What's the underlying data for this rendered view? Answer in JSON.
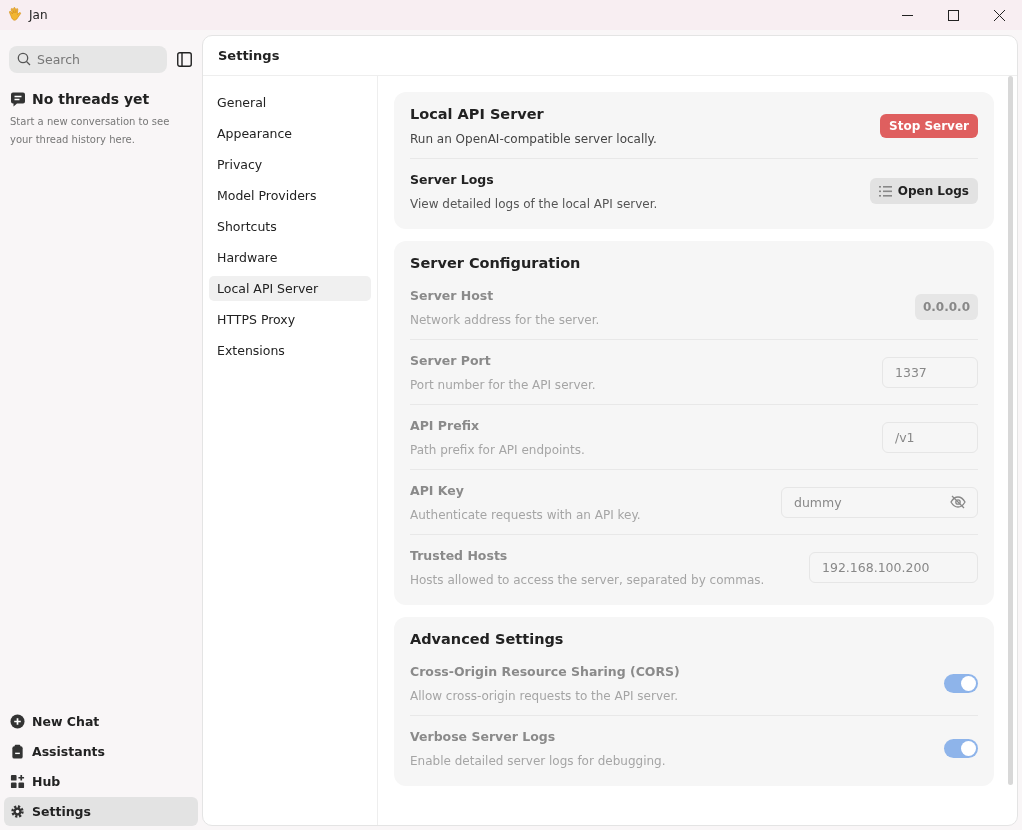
{
  "window": {
    "title": "Jan"
  },
  "sidebar": {
    "search": {
      "placeholder": "Search"
    },
    "empty_state": {
      "title": "No threads yet",
      "description": "Start a new conversation to see your thread history here."
    },
    "nav": [
      {
        "kind": "new-chat",
        "label": "New Chat",
        "selected": false
      },
      {
        "kind": "assistants",
        "label": "Assistants",
        "selected": false
      },
      {
        "kind": "hub",
        "label": "Hub",
        "selected": false
      },
      {
        "kind": "settings",
        "label": "Settings",
        "selected": true
      }
    ]
  },
  "settings": {
    "title": "Settings",
    "menu": [
      {
        "label": "General",
        "selected": false
      },
      {
        "label": "Appearance",
        "selected": false
      },
      {
        "label": "Privacy",
        "selected": false
      },
      {
        "label": "Model Providers",
        "selected": false
      },
      {
        "label": "Shortcuts",
        "selected": false
      },
      {
        "label": "Hardware",
        "selected": false
      },
      {
        "label": "Local API Server",
        "selected": true
      },
      {
        "label": "HTTPS Proxy",
        "selected": false
      },
      {
        "label": "Extensions",
        "selected": false
      }
    ],
    "sections": [
      {
        "title": "Local API Server",
        "description": "Run an OpenAI-compatible server locally.",
        "action": {
          "label": "Stop Server",
          "kind": "danger"
        },
        "rows": [
          {
            "kind": "button",
            "label": "Server Logs",
            "description": "View detailed logs of the local API server.",
            "disabled": false,
            "button": "Open Logs"
          }
        ]
      },
      {
        "title": "Server Configuration",
        "rows": [
          {
            "kind": "badge",
            "label": "Server Host",
            "description": "Network address for the server.",
            "disabled": true,
            "value": "0.0.0.0"
          },
          {
            "kind": "input",
            "label": "Server Port",
            "description": "Port number for the API server.",
            "disabled": true,
            "value": "1337"
          },
          {
            "kind": "input",
            "label": "API Prefix",
            "description": "Path prefix for API endpoints.",
            "disabled": true,
            "value": "/v1"
          },
          {
            "kind": "password",
            "label": "API Key",
            "description": "Authenticate requests with an API key.",
            "disabled": true,
            "value": "dummy"
          },
          {
            "kind": "input-wide",
            "label": "Trusted Hosts",
            "description": "Hosts allowed to access the server, separated by commas.",
            "disabled": true,
            "value": "192.168.100.200"
          }
        ]
      },
      {
        "title": "Advanced Settings",
        "rows": [
          {
            "kind": "toggle",
            "label": "Cross-Origin Resource Sharing (CORS)",
            "description": "Allow cross-origin requests to the API server.",
            "disabled": true,
            "on": true
          },
          {
            "kind": "toggle",
            "label": "Verbose Server Logs",
            "description": "Enable detailed server logs for debugging.",
            "disabled": true,
            "on": true
          }
        ]
      }
    ]
  }
}
